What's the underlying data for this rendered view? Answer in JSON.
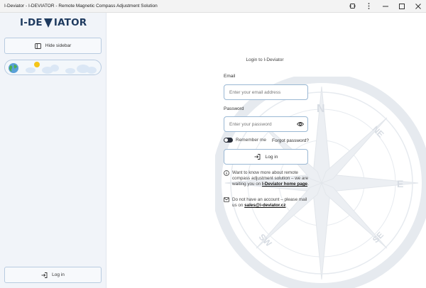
{
  "window": {
    "title": "I-Deviator - I-DEVIATOR - Remote Magnetic Compass Adjustment Solution"
  },
  "sidebar": {
    "logo_left": "I-DE",
    "logo_right": "IATOR",
    "hide_label": "Hide sidebar",
    "login_label": "Log in"
  },
  "form": {
    "heading": "Login to I-Deviator",
    "email_label": "Email",
    "email_placeholder": "Enter your email address",
    "password_label": "Password",
    "password_placeholder": "Enter your password",
    "remember_label": "Remember me",
    "forgot_label": "Forgot password?",
    "login_label": "Log in"
  },
  "info": {
    "text1": "Want to know more about remote compass adjustment solution – we are waiting you on ",
    "link1": "I-Deviator home page",
    "text1_end": ".",
    "text2": "Do not have an account – please mail us on ",
    "link2": "sales@i-deviator.cz"
  },
  "compass_labels": {
    "n": "N",
    "ne": "NE",
    "e": "E",
    "se": "SE",
    "sw": "SW"
  },
  "icons": [
    "restore-icon",
    "more-icon",
    "minimize-icon",
    "maximize-icon",
    "close-icon",
    "sidebar-icon",
    "login-icon",
    "eye-icon",
    "info-icon",
    "mail-icon",
    "globe-icon",
    "sun-icon",
    "cloud-icon"
  ],
  "colors": {
    "accent_border": "#9ab8d4",
    "logo": "#1e3a5f",
    "sidebar_bg": "#f1f4f9"
  }
}
